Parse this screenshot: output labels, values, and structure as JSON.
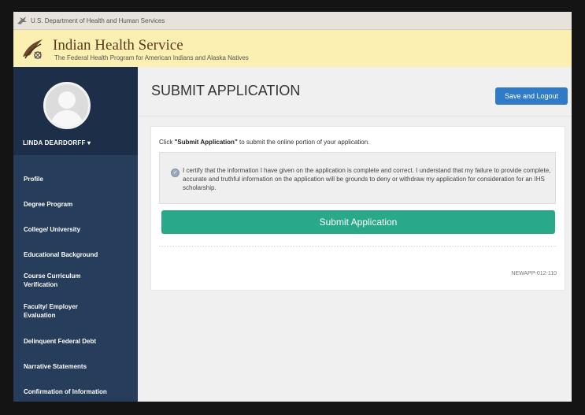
{
  "agency_bar": {
    "text": "U.S. Department of Health and Human Services"
  },
  "header": {
    "title": "Indian Health Service",
    "subtitle": "The Federal Health Program for American Indians and Alaska Natives"
  },
  "user": {
    "name": "LINDA DEARDORFF",
    "caret": "▾"
  },
  "sidebar": {
    "items": [
      {
        "label": "Profile"
      },
      {
        "label": "Degree Program"
      },
      {
        "label": "College/ University"
      },
      {
        "label": "Educational Background"
      },
      {
        "label": "Course Curriculum Verification"
      },
      {
        "label": "Faculty/ Employer Evaluation"
      },
      {
        "label": "Delinquent Federal Debt"
      },
      {
        "label": "Narrative Statements"
      },
      {
        "label": "Confirmation of Information"
      }
    ]
  },
  "main": {
    "title": "SUBMIT APPLICATION",
    "save_logout": "Save and Logout",
    "intro_prefix": "Click ",
    "intro_bold": "\"Submit Application\"",
    "intro_suffix": " to submit the online portion of your application.",
    "certification": "I certify that the information I have given on the application is complete and correct. I understand that my failure to provide complete, accurate and truthful information on the application will be grounds to deny or withdraw my application for consideration for an IHS scholarship.",
    "submit_label": "Submit Application",
    "form_code": "NEWAPP-012-110"
  },
  "colors": {
    "sidebar": "#273d5c",
    "header": "#fcefb2",
    "save_button": "#2f7bc7",
    "submit_button": "#29a98a"
  }
}
